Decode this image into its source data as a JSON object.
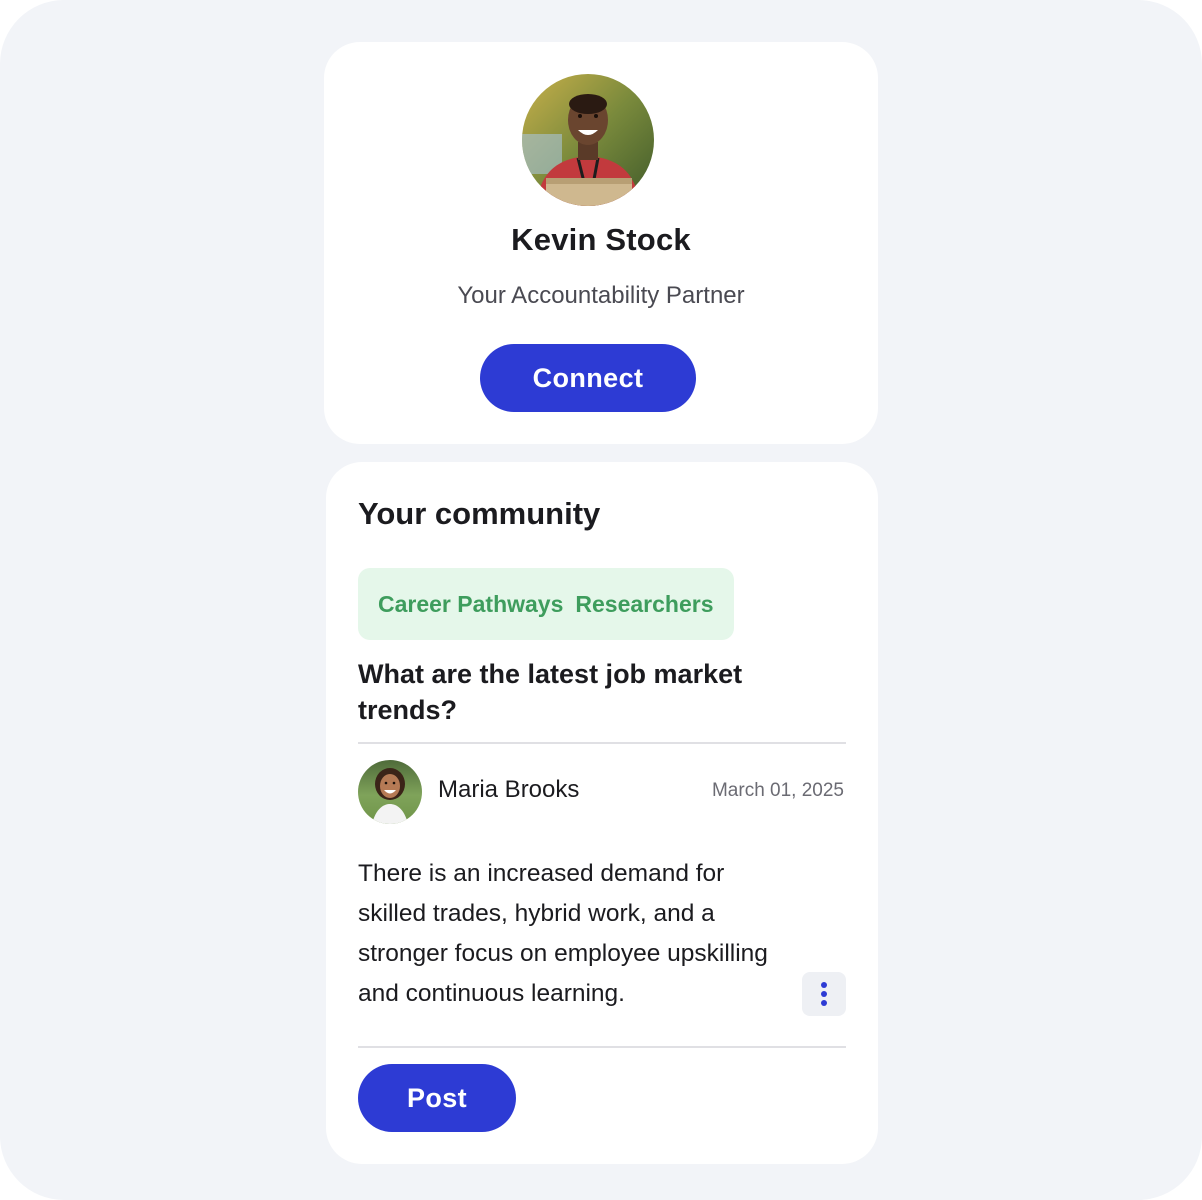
{
  "profile": {
    "name": "Kevin Stock",
    "role": "Your Accountability Partner",
    "connect_label": "Connect"
  },
  "community": {
    "title": "Your community",
    "tags": [
      "Career Pathways",
      "Researchers"
    ],
    "question": "What are the latest job market trends?",
    "answer": {
      "author": "Maria Brooks",
      "date": "March 01, 2025",
      "text": "There is an increased demand for skilled trades, hybrid work, and a stronger focus on employee upskilling and continuous learning."
    },
    "post_label": "Post"
  },
  "icons": {
    "more": "more-vertical-icon"
  },
  "colors": {
    "primary": "#2d3bd4",
    "tag_bg": "#e5f7ea",
    "tag_text": "#3e9d5d",
    "background": "#f2f4f8"
  }
}
